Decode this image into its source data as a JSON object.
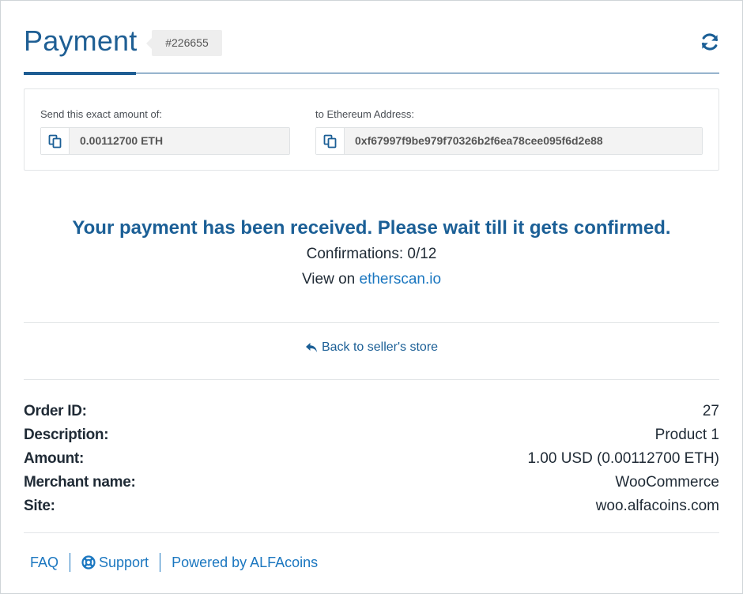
{
  "header": {
    "title": "Payment",
    "order_tag": "#226655"
  },
  "payment": {
    "amount_label": "Send this exact amount of:",
    "amount_value": "0.00112700 ETH",
    "address_label": "to Ethereum Address:",
    "address_value": "0xf67997f9be979f70326b2f6ea78cee095f6d2e88"
  },
  "status": {
    "message": "Your payment has been received. Please wait till it gets confirmed.",
    "confirmations": "Confirmations: 0/12",
    "view_prefix": "View on",
    "view_link": "etherscan.io"
  },
  "back_link": "Back to seller's store",
  "details": [
    {
      "label": "Order ID:",
      "value": "27"
    },
    {
      "label": "Description:",
      "value": "Product 1"
    },
    {
      "label": "Amount:",
      "value": "1.00 USD (0.00112700 ETH)"
    },
    {
      "label": "Merchant name:",
      "value": "WooCommerce"
    },
    {
      "label": "Site:",
      "value": "woo.alfacoins.com"
    }
  ],
  "footer": {
    "faq": "FAQ",
    "support": "Support",
    "powered": "Powered by ALFAcoins"
  },
  "colors": {
    "accent": "#1b5f96",
    "link": "#1b77c0",
    "border": "#e3e6e8"
  },
  "icons": [
    "refresh-icon",
    "copy-icon",
    "reply-arrow-icon",
    "life-ring-icon"
  ]
}
